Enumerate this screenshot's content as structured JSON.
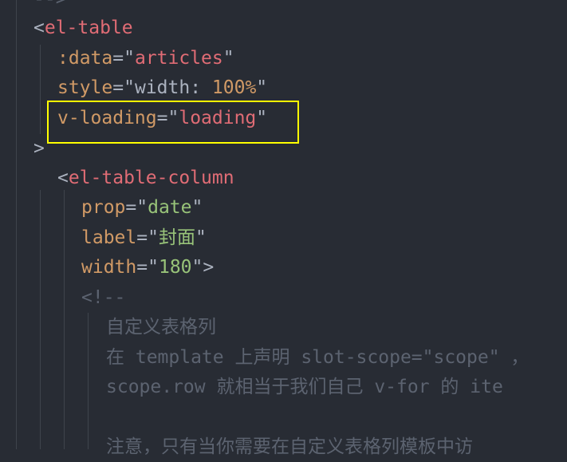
{
  "code": {
    "line_0_partial": "-->",
    "line_1_open": "<",
    "line_1_tag": "el-table",
    "line_2_attr": ":data",
    "line_2_eq": "=",
    "line_2_q1": "\"",
    "line_2_val": "articles",
    "line_2_q2": "\"",
    "line_3_attr": "style",
    "line_3_eq": "=",
    "line_3_q1": "\"",
    "line_3_val_prefix": "width: ",
    "line_3_val_num": "100%",
    "line_3_q2": "\"",
    "line_4_attr": "v-loading",
    "line_4_eq": "=",
    "line_4_q1": "\"",
    "line_4_val": "loading",
    "line_4_q2": "\"",
    "line_5_close": ">",
    "line_6_open": "<",
    "line_6_tag": "el-table-column",
    "line_7_attr": "prop",
    "line_7_eq": "=",
    "line_7_q1": "\"",
    "line_7_val": "date",
    "line_7_q2": "\"",
    "line_8_attr": "label",
    "line_8_eq": "=",
    "line_8_q1": "\"",
    "line_8_val": "封面",
    "line_8_q2": "\"",
    "line_9_attr": "width",
    "line_9_eq": "=",
    "line_9_q1": "\"",
    "line_9_val": "180",
    "line_9_q2": "\"",
    "line_9_close": ">",
    "line_10_comment": "<!--",
    "line_11_comment": "自定义表格列",
    "line_12_comment": "在 template 上声明 slot-scope=\"scope\" ，",
    "line_13_comment": "scope.row 就相当于我们自己 v-for 的 ite",
    "line_15_comment": "注意，只有当你需要在自定义表格列模板中访"
  }
}
